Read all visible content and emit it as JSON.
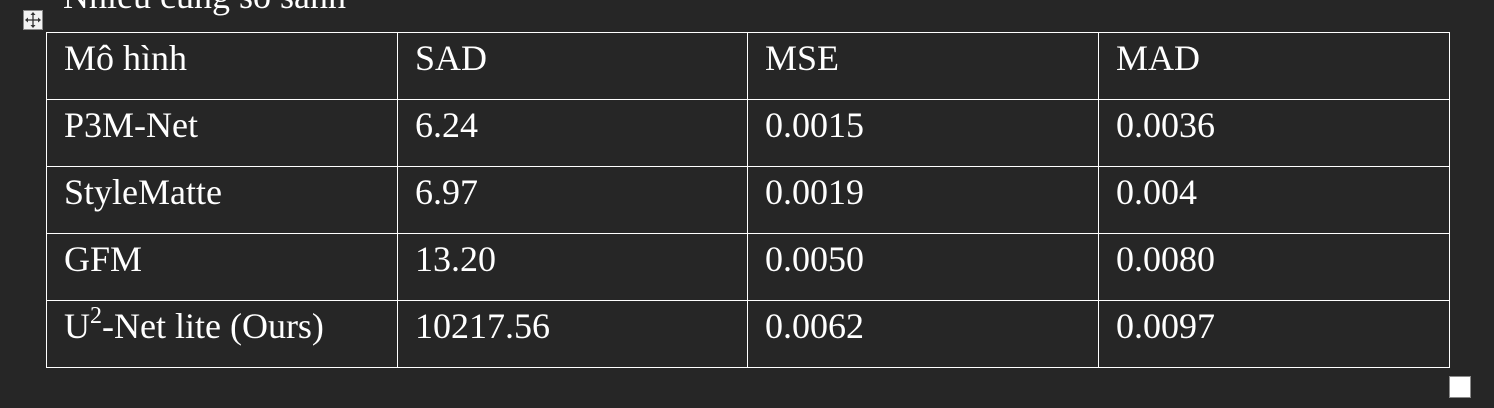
{
  "caption_fragment": "Nhiễu cũng số sánh",
  "table": {
    "header": [
      "Mô hình",
      "SAD",
      "MSE",
      "MAD"
    ],
    "rows": [
      {
        "model": "P3M-Net",
        "sad": "6.24",
        "mse": "0.0015",
        "mad": "0.0036"
      },
      {
        "model": "StyleMatte",
        "sad": "6.97",
        "mse": "0.0019",
        "mad": "0.004"
      },
      {
        "model": "GFM",
        "sad": "13.20",
        "mse": "0.0050",
        "mad": "0.0080"
      },
      {
        "model_prefix": "U",
        "model_sup": "2",
        "model_suffix": "-Net lite (Ours)",
        "sad": "10217.56",
        "mse": "0.0062",
        "mad": "0.0097"
      }
    ]
  },
  "icons": {
    "move_handle": "move-arrows-icon",
    "resize_handle": "resize-square-icon"
  }
}
